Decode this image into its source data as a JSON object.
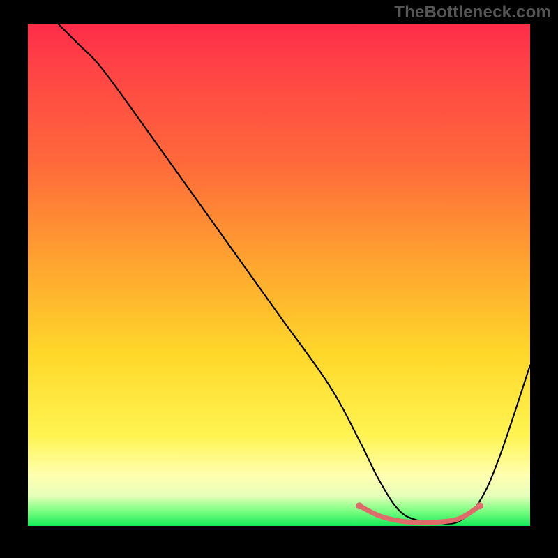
{
  "watermark": "TheBottleneck.com",
  "chart_data": {
    "type": "line",
    "title": "",
    "xlabel": "",
    "ylabel": "",
    "xlim": [
      0,
      100
    ],
    "ylim": [
      0,
      100
    ],
    "series": [
      {
        "name": "main-curve",
        "x": [
          6,
          10,
          14,
          20,
          30,
          40,
          50,
          60,
          66,
          70,
          74,
          78,
          82,
          86,
          90,
          94,
          100
        ],
        "y": [
          100,
          96,
          92,
          84,
          70,
          56,
          42,
          28,
          17,
          9,
          3,
          1,
          0.5,
          1,
          5,
          14,
          32
        ]
      },
      {
        "name": "highlight-segment",
        "description": "coral rounded segment near valley floor",
        "x": [
          66,
          70,
          74,
          78,
          82,
          86,
          90
        ],
        "y": [
          4,
          2,
          1,
          0.7,
          0.8,
          1.5,
          4
        ]
      }
    ],
    "annotations": [],
    "legend": false,
    "grid": false
  },
  "colors": {
    "curve": "#000000",
    "highlight": "#e06b6b",
    "gradient_top": "#ff2c4a",
    "gradient_bottom": "#17e95a"
  }
}
